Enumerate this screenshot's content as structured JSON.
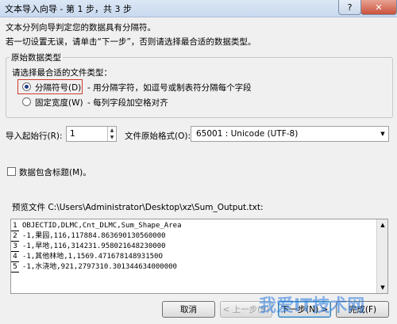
{
  "window": {
    "title": "文本导入向导 - 第 1 步，共 3 步",
    "help_glyph": "?",
    "close_glyph": "✕"
  },
  "intro": {
    "line1": "文本分列向导判定您的数据具有分隔符。",
    "line2": "若一切设置无误，请单击“下一步”，否则请选择最合适的数据类型。"
  },
  "group": {
    "title": "原始数据类型",
    "prompt": "请选择最合适的文件类型：",
    "option_delimited": {
      "label": "分隔符号(D)",
      "desc": "- 用分隔字符，如逗号或制表符分隔每个字段",
      "selected": true
    },
    "option_fixed": {
      "label": "固定宽度(W)",
      "desc": "- 每列字段加空格对齐",
      "selected": false
    }
  },
  "import": {
    "start_row_label": "导入起始行(R):",
    "start_row_value": "1",
    "origin_label": "文件原始格式(O):",
    "origin_value": "65001 : Unicode (UTF-8)"
  },
  "headers_checkbox": {
    "label": "数据包含标题(M)。",
    "checked": false
  },
  "preview": {
    "label": "预览文件 C:\\Users\\Administrator\\Desktop\\xz\\Sum_Output.txt:",
    "rows": [
      {
        "num": "1",
        "text": "OBJECTID,DLMC,Cnt_DLMC,Sum_Shape_Area"
      },
      {
        "num": "2",
        "text": "-1,果园,116,117884.863690130560000"
      },
      {
        "num": "3",
        "text": "-1,旱地,116,314231.958021648230000"
      },
      {
        "num": "4",
        "text": "-1,其他林地,1,1569.47167814893150O"
      },
      {
        "num": "5",
        "text": "-1,水浇地,921,2797310.301344634000000"
      }
    ]
  },
  "buttons": {
    "cancel": "取消",
    "back": "< 上一步(B)",
    "next": "下一步(N) >",
    "finish": "完成(F)"
  },
  "watermark": "我爱IT技术网"
}
